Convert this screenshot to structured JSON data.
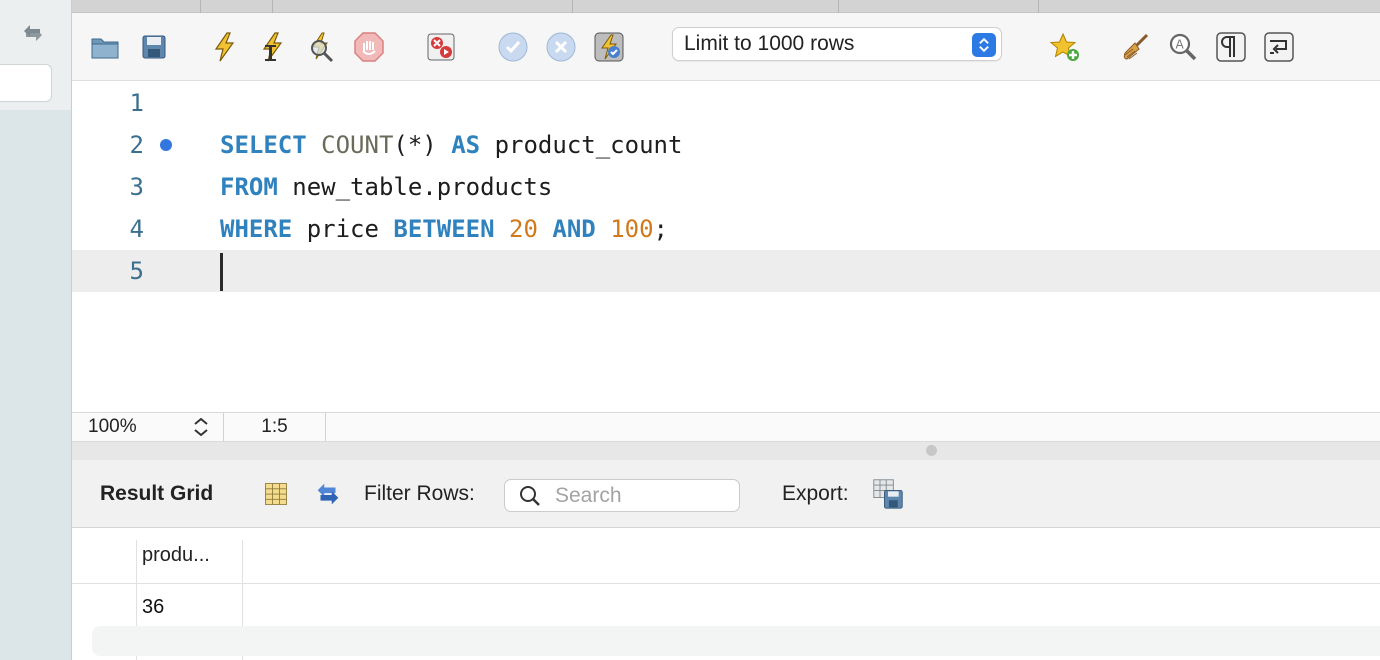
{
  "toolbar": {
    "limit_select": "Limit to 1000 rows",
    "icons": [
      "open-folder-icon",
      "save-icon",
      "execute-icon",
      "execute-current-icon",
      "explain-icon",
      "stop-icon",
      "toggle-error-icon",
      "commit-icon",
      "rollback-icon",
      "autocommit-icon",
      "add-snippet-icon",
      "beautify-icon",
      "find-icon",
      "invisibles-icon",
      "wrap-icon"
    ]
  },
  "editor": {
    "line_numbers": [
      "1",
      "2",
      "3",
      "4",
      "5"
    ],
    "lines": [
      [],
      [
        {
          "t": "SELECT",
          "c": "kw"
        },
        {
          "t": " ",
          "c": ""
        },
        {
          "t": "COUNT",
          "c": "fn"
        },
        {
          "t": "(*)",
          "c": "punct"
        },
        {
          "t": " ",
          "c": ""
        },
        {
          "t": "AS",
          "c": "kw"
        },
        {
          "t": " product_count",
          "c": ""
        }
      ],
      [
        {
          "t": "FROM",
          "c": "kw"
        },
        {
          "t": " new_table.products",
          "c": ""
        }
      ],
      [
        {
          "t": "WHERE",
          "c": "kw"
        },
        {
          "t": " price ",
          "c": ""
        },
        {
          "t": "BETWEEN",
          "c": "kw"
        },
        {
          "t": " ",
          "c": ""
        },
        {
          "t": "20",
          "c": "num"
        },
        {
          "t": " ",
          "c": ""
        },
        {
          "t": "AND",
          "c": "kw"
        },
        {
          "t": " ",
          "c": ""
        },
        {
          "t": "100",
          "c": "num"
        },
        {
          "t": ";",
          "c": "punct"
        }
      ],
      []
    ]
  },
  "status": {
    "zoom": "100%",
    "cursor": "1:5"
  },
  "result": {
    "title": "Result Grid",
    "filter_label": "Filter Rows:",
    "search_placeholder": "Search",
    "export_label": "Export:",
    "columns": [
      "produ..."
    ],
    "rows": [
      [
        "36"
      ]
    ]
  }
}
